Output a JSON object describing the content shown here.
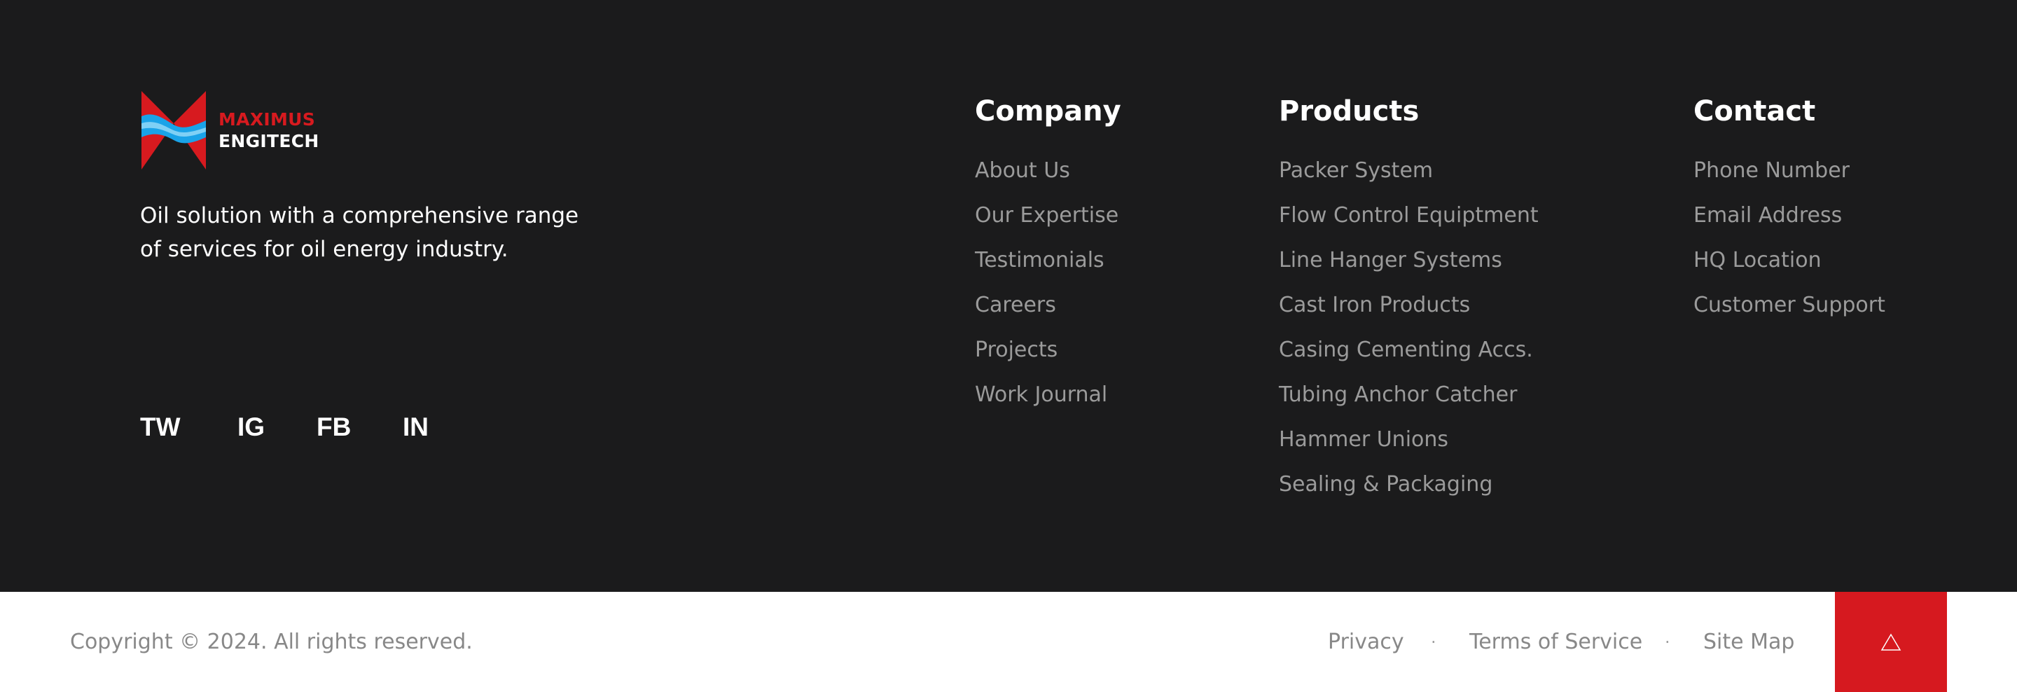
{
  "brand": {
    "name_line1": "MAXIMUS",
    "name_line2": "ENGITECH",
    "tagline": "Oil solution with a comprehensive range of services for oil energy industry.",
    "colors": {
      "red": "#d71a1f",
      "blue": "#1aa3e8",
      "background": "#1b1b1c"
    }
  },
  "social": {
    "items": [
      "TW",
      "IG",
      "FB",
      "IN"
    ]
  },
  "columns": {
    "company": {
      "title": "Company",
      "links": [
        "About Us",
        "Our Expertise",
        "Testimonials",
        "Careers",
        "Projects",
        "Work Journal"
      ]
    },
    "products": {
      "title": "Products",
      "links": [
        "Packer System",
        "Flow Control Equiptment",
        "Line Hanger Systems",
        "Cast Iron Products",
        "Casing Cementing Accs.",
        "Tubing Anchor Catcher",
        "Hammer Unions",
        "Sealing & Packaging"
      ]
    },
    "contact": {
      "title": "Contact",
      "links": [
        "Phone Number",
        "Email Address",
        "HQ Location",
        "Customer Support"
      ]
    }
  },
  "bottom": {
    "copyright": "Copyright © 2024. All rights reserved.",
    "links": [
      "Privacy",
      "Terms of Service",
      "Site Map"
    ],
    "separator": "·",
    "back_to_top_icon": "triangle-up-icon"
  }
}
